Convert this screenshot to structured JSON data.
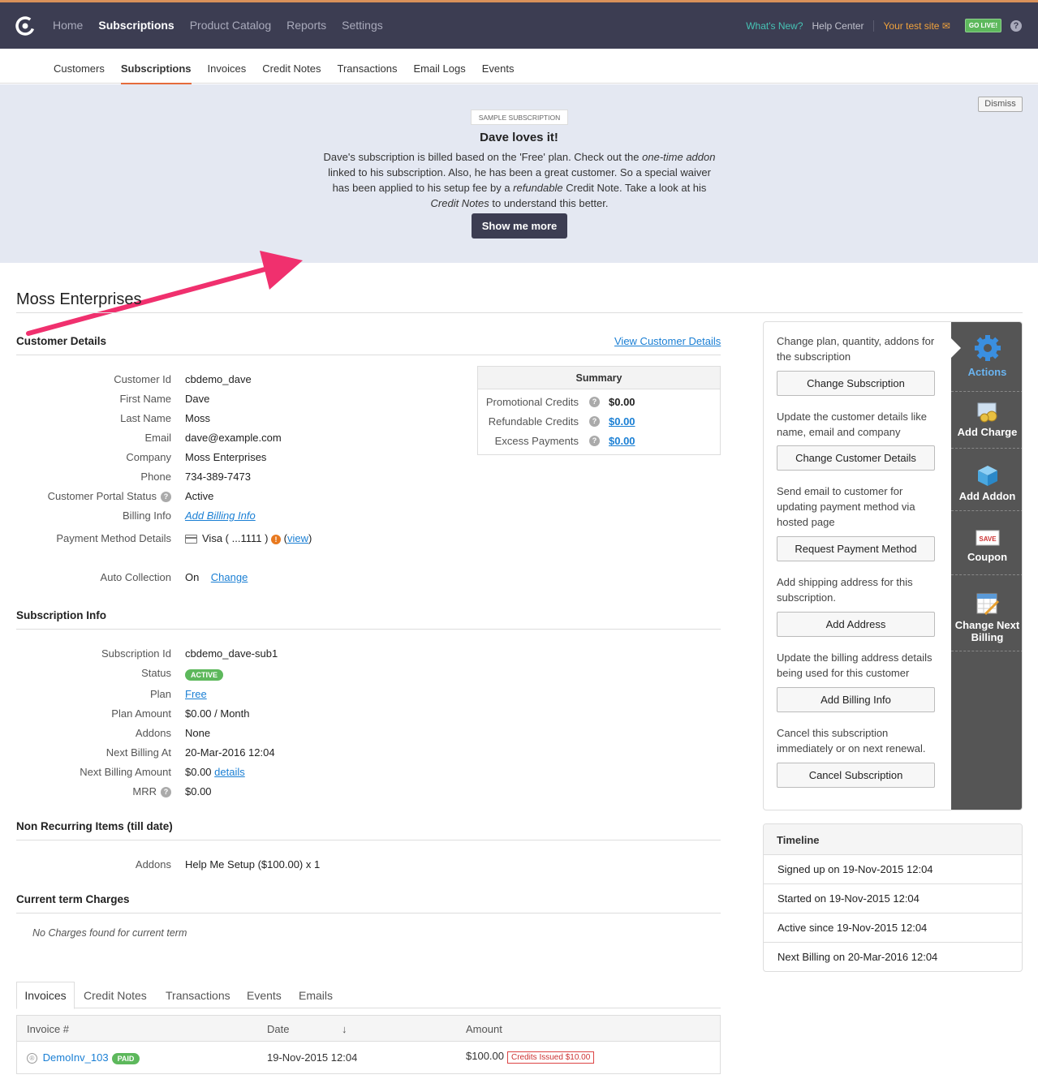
{
  "topnav": {
    "items": [
      "Home",
      "Subscriptions",
      "Product Catalog",
      "Reports",
      "Settings"
    ],
    "active": "Subscriptions",
    "whats_new": "What's New?",
    "help_center": "Help Center",
    "site": "Your test site",
    "go_live": "GO LIVE!",
    "help_icon": "?"
  },
  "subnav": {
    "items": [
      "Customers",
      "Subscriptions",
      "Invoices",
      "Credit Notes",
      "Transactions",
      "Email Logs",
      "Events"
    ],
    "active": "Subscriptions"
  },
  "banner": {
    "tag": "SAMPLE SUBSCRIPTION",
    "title": "Dave loves it!",
    "desc_parts": [
      {
        "t": "Dave's subscription is billed based on the 'Free' plan. Check out the ",
        "i": false
      },
      {
        "t": "one-time addon",
        "i": true
      },
      {
        "t": " linked to his subscription. Also, he has been a great customer. So a special waiver has been applied to his setup fee by a ",
        "i": false
      },
      {
        "t": "refundable",
        "i": true
      },
      {
        "t": " Credit Note. Take a look at his ",
        "i": false
      },
      {
        "t": "Credit Notes",
        "i": true
      },
      {
        "t": " to understand this better.",
        "i": false
      }
    ],
    "show_more": "Show me more",
    "dismiss": "Dismiss",
    "arrow_color": "#f0306e"
  },
  "page": {
    "title": "Moss Enterprises"
  },
  "customer_details": {
    "heading": "Customer Details",
    "view_link": "View Customer Details",
    "customer_id_label": "Customer Id",
    "customer_id": "cbdemo_dave",
    "first_name_label": "First Name",
    "first_name": "Dave",
    "last_name_label": "Last Name",
    "last_name": "Moss",
    "email_label": "Email",
    "email": "dave@example.com",
    "company_label": "Company",
    "company": "Moss Enterprises",
    "phone_label": "Phone",
    "phone": "734-389-7473",
    "portal_label": "Customer Portal Status",
    "portal": "Active",
    "billing_label": "Billing Info",
    "billing": "Add Billing Info",
    "payment_label": "Payment Method Details",
    "payment_card": "Visa ( ...1111 )",
    "payment_view": "view",
    "auto_label": "Auto Collection",
    "auto": "On",
    "auto_change": "Change"
  },
  "summary": {
    "heading": "Summary",
    "rows": [
      {
        "label": "Promotional Credits",
        "value": "$0.00"
      },
      {
        "label": "Refundable Credits",
        "value": "$0.00"
      },
      {
        "label": "Excess Payments",
        "value": "$0.00"
      }
    ]
  },
  "subscription_info": {
    "heading": "Subscription Info",
    "id_label": "Subscription Id",
    "id": "cbdemo_dave-sub1",
    "status_label": "Status",
    "status": "ACTIVE",
    "plan_label": "Plan",
    "plan": "Free",
    "amount_label": "Plan Amount",
    "amount": "$0.00 / Month",
    "addons_label": "Addons",
    "addons": "None",
    "next_label": "Next Billing At",
    "next": "20-Mar-2016 12:04",
    "next_amount_label": "Next Billing Amount",
    "next_amount": "$0.00",
    "next_details": "details",
    "mrr_label": "MRR",
    "mrr": "$0.00"
  },
  "non_recurring": {
    "heading": "Non Recurring Items (till date)",
    "addons_label": "Addons",
    "addons": "Help Me Setup ($100.00) x 1"
  },
  "current_term": {
    "heading": "Current term Charges",
    "empty": "No Charges found for current term"
  },
  "bottom_tabs": {
    "items": [
      "Invoices",
      "Credit Notes",
      "Transactions",
      "Events",
      "Emails"
    ],
    "active": "Invoices"
  },
  "invoice_table": {
    "headers": [
      "Invoice #",
      "Date",
      "Amount"
    ],
    "sort_icon": "↓",
    "rows": [
      {
        "id": "DemoInv_103",
        "badge": "PAID",
        "date": "19-Nov-2015 12:04",
        "amount": "$100.00",
        "credits": "Credits Issued $10.00"
      }
    ]
  },
  "actions": {
    "items": [
      {
        "desc": "Change plan, quantity, addons for the subscription",
        "button": "Change Subscription"
      },
      {
        "desc": "Update the customer details like name, email and company",
        "button": "Change Customer Details"
      },
      {
        "desc": "Send email to customer for updating payment method via hosted page",
        "button": "Request Payment Method"
      },
      {
        "desc": "Add shipping address for this subscription.",
        "button": "Add Address"
      },
      {
        "desc": "Update the billing address details being used for this customer",
        "button": "Add Billing Info"
      },
      {
        "desc": "Cancel this subscription immediately or on next renewal.",
        "button": "Cancel Subscription"
      }
    ],
    "sidebar": [
      {
        "label": "Actions",
        "icon": "gear-icon"
      },
      {
        "label": "Add Charge",
        "icon": "coins-icon"
      },
      {
        "label": "Add Addon",
        "icon": "cube-icon"
      },
      {
        "label": "Coupon",
        "icon": "coupon-icon",
        "icon_text": "SAVE"
      },
      {
        "label": "Change Next Billing",
        "icon": "calendar-icon"
      }
    ]
  },
  "timeline": {
    "heading": "Timeline",
    "items": [
      "Signed up on 19-Nov-2015 12:04",
      "Started on 19-Nov-2015 12:04",
      "Active since 19-Nov-2015 12:04",
      "Next Billing on 20-Mar-2016 12:04"
    ]
  }
}
